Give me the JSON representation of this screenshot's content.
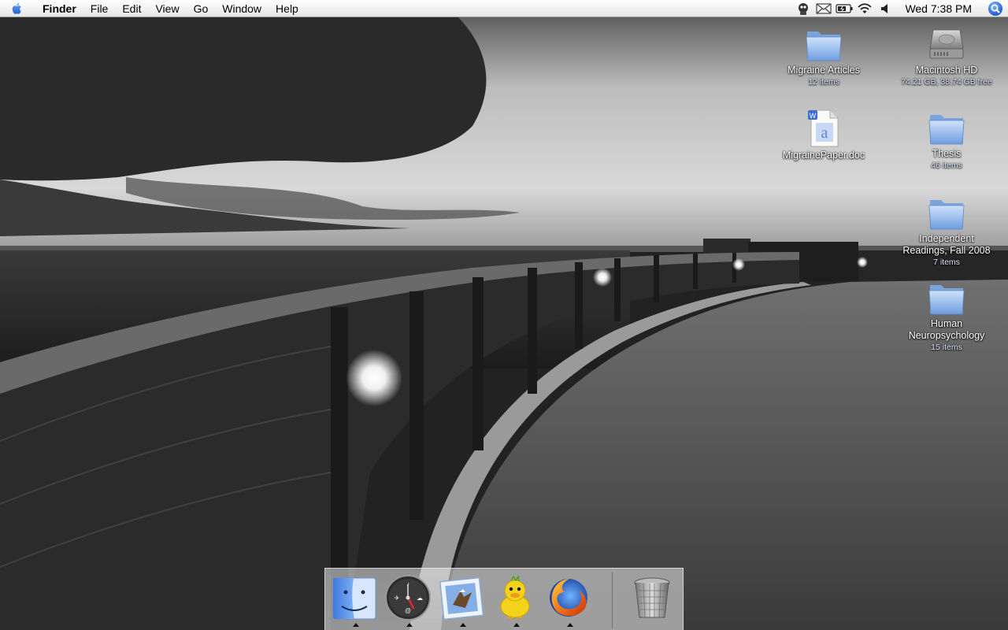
{
  "menubar": {
    "apple_icon": "apple-logo-icon",
    "app_name": "Finder",
    "menus": [
      "File",
      "Edit",
      "View",
      "Go",
      "Window",
      "Help"
    ],
    "status_icons": [
      "adium-robot-icon",
      "mail-envelope-icon",
      "battery-icon",
      "wifi-icon",
      "volume-icon"
    ],
    "clock": "Wed 7:38 PM",
    "spotlight_icon": "spotlight-search-icon"
  },
  "desktop_icons": [
    {
      "id": "migraine-articles",
      "name": "Migraine Articles",
      "info": "12 items",
      "type": "folder"
    },
    {
      "id": "macintosh-hd",
      "name": "Macintosh HD",
      "info": "74.21 GB, 38.74 GB free",
      "type": "hard-drive"
    },
    {
      "id": "migraine-paper",
      "name": "MigrainePaper.doc",
      "info": "",
      "type": "word-document"
    },
    {
      "id": "thesis",
      "name": "Thesis",
      "info": "46 items",
      "type": "folder"
    },
    {
      "id": "independent-readings",
      "name_line1": "Independent",
      "name_line2": "Readings, Fall 2008",
      "info": "7 items",
      "type": "folder"
    },
    {
      "id": "human-neuropsychology",
      "name_line1": "Human",
      "name_line2": "Neuropsychology",
      "info": "15 items",
      "type": "folder"
    }
  ],
  "dock": {
    "items": [
      "finder-icon",
      "dashboard-icon",
      "mail-icon",
      "adium-duck-icon",
      "firefox-icon",
      "trash-icon"
    ]
  },
  "colors": {
    "folder_blue": "#8fb4e8",
    "menubar": "#f2f2f2",
    "label_text": "#ffffff"
  }
}
